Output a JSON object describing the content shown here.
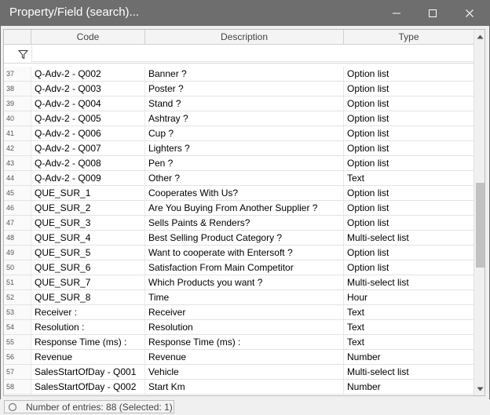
{
  "window": {
    "title": "Property/Field (search)..."
  },
  "columns": {
    "code": "Code",
    "description": "Description",
    "type": "Type"
  },
  "rows": [
    {
      "index": "37",
      "code": "Q-Adv-2 - Q002",
      "description": "Banner ?",
      "type": "Option list"
    },
    {
      "index": "38",
      "code": "Q-Adv-2 - Q003",
      "description": "Poster ?",
      "type": "Option list"
    },
    {
      "index": "39",
      "code": "Q-Adv-2 - Q004",
      "description": "Stand ?",
      "type": "Option list"
    },
    {
      "index": "40",
      "code": "Q-Adv-2 - Q005",
      "description": "Ashtray ?",
      "type": "Option list"
    },
    {
      "index": "41",
      "code": "Q-Adv-2 - Q006",
      "description": "Cup ?",
      "type": "Option list"
    },
    {
      "index": "42",
      "code": "Q-Adv-2 - Q007",
      "description": "Lighters ?",
      "type": "Option list"
    },
    {
      "index": "43",
      "code": "Q-Adv-2 - Q008",
      "description": "Pen ?",
      "type": "Option list"
    },
    {
      "index": "44",
      "code": "Q-Adv-2 - Q009",
      "description": "Other ?",
      "type": "Text"
    },
    {
      "index": "45",
      "code": "QUE_SUR_1",
      "description": "Cooperates With Us?",
      "type": "Option list"
    },
    {
      "index": "46",
      "code": "QUE_SUR_2",
      "description": "Are You Buying From Another Supplier ?",
      "type": "Option list"
    },
    {
      "index": "47",
      "code": "QUE_SUR_3",
      "description": "Sells Paints & Renders?",
      "type": "Option list"
    },
    {
      "index": "48",
      "code": "QUE_SUR_4",
      "description": "Best Selling Product Category ?",
      "type": "Multi-select list"
    },
    {
      "index": "49",
      "code": "QUE_SUR_5",
      "description": "Want to cooperate with Entersoft ?",
      "type": "Option list"
    },
    {
      "index": "50",
      "code": "QUE_SUR_6",
      "description": "Satisfaction From Main Competitor",
      "type": "Option list"
    },
    {
      "index": "51",
      "code": "QUE_SUR_7",
      "description": "Which Products you want ?",
      "type": "Multi-select list"
    },
    {
      "index": "52",
      "code": "QUE_SUR_8",
      "description": "Time",
      "type": "Hour"
    },
    {
      "index": "53",
      "code": "Receiver :",
      "description": "Receiver",
      "type": "Text"
    },
    {
      "index": "54",
      "code": "Resolution :",
      "description": "Resolution",
      "type": "Text"
    },
    {
      "index": "55",
      "code": "Response Time (ms) :",
      "description": "Response Time (ms) :",
      "type": "Text"
    },
    {
      "index": "56",
      "code": "Revenue",
      "description": "Revenue",
      "type": "Number"
    },
    {
      "index": "57",
      "code": "SalesStartOfDay - Q001",
      "description": "Vehicle",
      "type": "Multi-select list"
    },
    {
      "index": "58",
      "code": "SalesStartOfDay - Q002",
      "description": "Start Km",
      "type": "Number"
    }
  ],
  "status": {
    "text": "Number of entries: 88 (Selected: 1)"
  },
  "icons": {
    "minimize": "minimize-icon",
    "maximize": "maximize-icon",
    "close": "close-icon",
    "filter": "filter-icon",
    "scroll_up": "scroll-up-icon",
    "scroll_down": "scroll-down-icon",
    "status": "status-circle-icon"
  },
  "colors": {
    "titlebar": "#6e6e6e",
    "title_text": "#ffffff",
    "grid_border": "#bcbcbc",
    "row_border": "#e3e3e3"
  }
}
